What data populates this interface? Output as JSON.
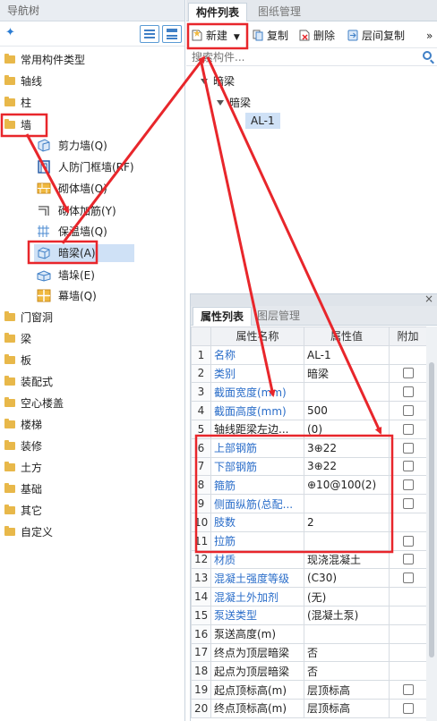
{
  "nav": {
    "title": "导航树",
    "add_glyph": "✦",
    "items": [
      {
        "label": "常用构件类型"
      },
      {
        "label": "轴线"
      },
      {
        "label": "柱"
      },
      {
        "label": "墙"
      },
      {
        "label": "门窗洞"
      },
      {
        "label": "梁"
      },
      {
        "label": "板"
      },
      {
        "label": "装配式"
      },
      {
        "label": "空心楼盖"
      },
      {
        "label": "楼梯"
      },
      {
        "label": "装修"
      },
      {
        "label": "土方"
      },
      {
        "label": "基础"
      },
      {
        "label": "其它"
      },
      {
        "label": "自定义"
      }
    ],
    "wall_children": [
      {
        "label": "剪力墙(Q)",
        "icon": "shear-wall-icon"
      },
      {
        "label": "人防门框墙(RF)",
        "icon": "civil-defense-door-frame-wall-icon"
      },
      {
        "label": "砌体墙(Q)",
        "icon": "masonry-wall-icon"
      },
      {
        "label": "砌体加筋(Y)",
        "icon": "masonry-rebar-icon"
      },
      {
        "label": "保温墙(Q)",
        "icon": "insulation-wall-icon"
      },
      {
        "label": "暗梁(A)",
        "icon": "hidden-beam-icon"
      },
      {
        "label": "墙垛(E)",
        "icon": "wall-pier-icon"
      },
      {
        "label": "幕墙(Q)",
        "icon": "curtain-wall-icon"
      }
    ]
  },
  "comp": {
    "tabs": [
      "构件列表",
      "图纸管理"
    ],
    "toolbar": {
      "new": "新建",
      "copy": "复制",
      "delete": "删除",
      "floor_copy": "层间复制",
      "more": "»"
    },
    "search_placeholder": "搜索构件...",
    "tree": {
      "root": "暗梁",
      "child": "暗梁",
      "leaf": "AL-1"
    }
  },
  "props": {
    "tabs": [
      "属性列表",
      "图层管理"
    ],
    "close": "×",
    "headers": [
      "属性名称",
      "属性值",
      "附加"
    ],
    "rows": [
      {
        "n": "1",
        "name": "名称",
        "value": "AL-1",
        "cb": false,
        "blue": true
      },
      {
        "n": "2",
        "name": "类别",
        "value": "暗梁",
        "cb": true,
        "blue": true
      },
      {
        "n": "3",
        "name": "截面宽度(mm)",
        "value": "",
        "cb": true,
        "blue": true
      },
      {
        "n": "4",
        "name": "截面高度(mm)",
        "value": "500",
        "cb": true,
        "blue": true
      },
      {
        "n": "5",
        "name": "轴线距梁左边...",
        "value": "(0)",
        "cb": true,
        "blue": false
      },
      {
        "n": "6",
        "name": "上部钢筋",
        "value": "3⊕22",
        "cb": true,
        "blue": true
      },
      {
        "n": "7",
        "name": "下部钢筋",
        "value": "3⊕22",
        "cb": true,
        "blue": true
      },
      {
        "n": "8",
        "name": "箍筋",
        "value": "⊕10@100(2)",
        "cb": true,
        "blue": true
      },
      {
        "n": "9",
        "name": "侧面纵筋(总配...",
        "value": "",
        "cb": true,
        "blue": true
      },
      {
        "n": "10",
        "name": "肢数",
        "value": "2",
        "cb": false,
        "blue": true
      },
      {
        "n": "11",
        "name": "拉筋",
        "value": "",
        "cb": true,
        "blue": true
      },
      {
        "n": "12",
        "name": "材质",
        "value": "现浇混凝土",
        "cb": true,
        "blue": true
      },
      {
        "n": "13",
        "name": "混凝土强度等级",
        "value": "(C30)",
        "cb": true,
        "blue": true
      },
      {
        "n": "14",
        "name": "混凝土外加剂",
        "value": "(无)",
        "cb": false,
        "blue": true
      },
      {
        "n": "15",
        "name": "泵送类型",
        "value": "(混凝土泵)",
        "cb": false,
        "blue": true
      },
      {
        "n": "16",
        "name": "泵送高度(m)",
        "value": "",
        "cb": false,
        "blue": false
      },
      {
        "n": "17",
        "name": "终点为顶层暗梁",
        "value": "否",
        "cb": false,
        "blue": false
      },
      {
        "n": "18",
        "name": "起点为顶层暗梁",
        "value": "否",
        "cb": false,
        "blue": false
      },
      {
        "n": "19",
        "name": "起点顶标高(m)",
        "value": "层顶标高",
        "cb": true,
        "blue": false
      },
      {
        "n": "20",
        "name": "终点顶标高(m)",
        "value": "层顶标高",
        "cb": true,
        "blue": false
      }
    ]
  },
  "colors": {
    "annotation": "#e8262b",
    "selection": "#cfe1f6",
    "link": "#2a6dc9"
  }
}
